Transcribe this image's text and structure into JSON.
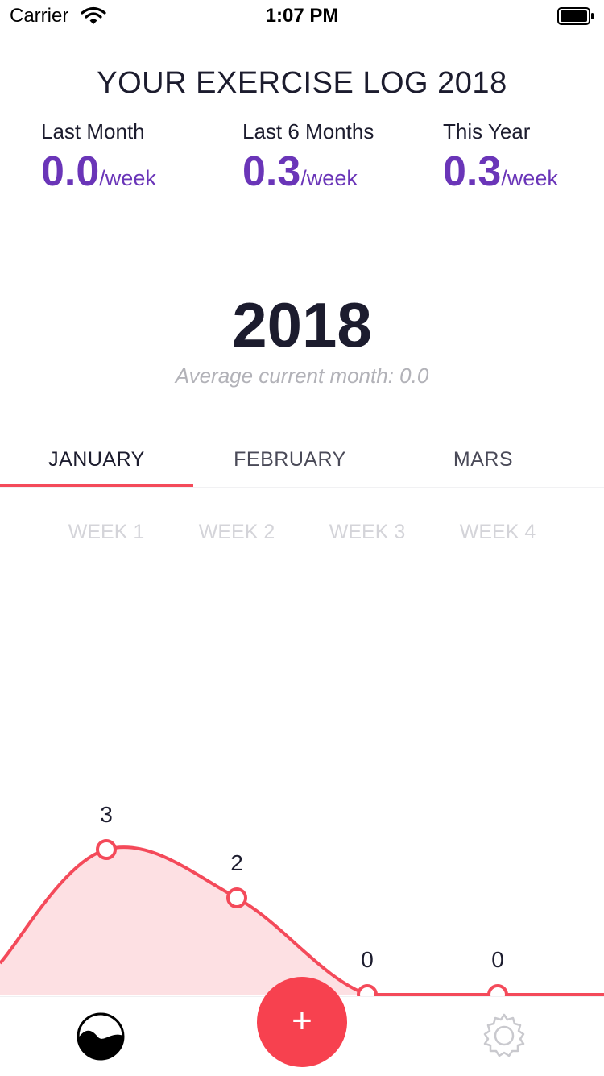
{
  "status_bar": {
    "carrier": "Carrier",
    "time": "1:07 PM"
  },
  "header": {
    "title": "YOUR EXERCISE LOG 2018"
  },
  "stats": [
    {
      "label": "Last Month",
      "value": "0.0",
      "unit": "/week"
    },
    {
      "label": "Last 6 Months",
      "value": "0.3",
      "unit": "/week"
    },
    {
      "label": "This Year",
      "value": "0.3",
      "unit": "/week"
    }
  ],
  "summary": {
    "year": "2018",
    "average_text": "Average current month: 0.0"
  },
  "months": {
    "tabs": [
      {
        "label": "JANUARY",
        "active": true
      },
      {
        "label": "FEBRUARY",
        "active": false
      },
      {
        "label": "MARS",
        "active": false
      }
    ]
  },
  "weeks": [
    "WEEK 1",
    "WEEK 2",
    "WEEK 3",
    "WEEK 4"
  ],
  "chart_data": {
    "type": "area",
    "categories": [
      "WEEK 1",
      "WEEK 2",
      "WEEK 3",
      "WEEK 4"
    ],
    "values": [
      3,
      2,
      0,
      0
    ],
    "data_labels": [
      "3",
      "2",
      "0",
      "0"
    ],
    "ylim": [
      0,
      4
    ],
    "grid": false,
    "colors": {
      "line": "#f44a5a",
      "fill": "#fde0e3"
    }
  },
  "tabbar": {
    "add_label": "+",
    "left_icon": "wave-icon",
    "right_icon": "gear-icon"
  },
  "colors": {
    "accent": "#f44a5a",
    "value_purple": "#6a35b8",
    "text_dark": "#1c1c2e"
  }
}
